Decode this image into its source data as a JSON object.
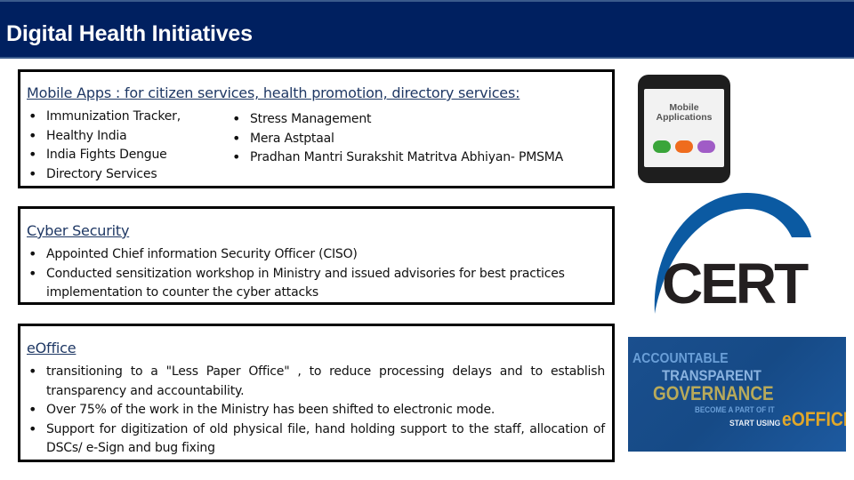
{
  "header": {
    "title": "Digital Health Initiatives"
  },
  "mobile_apps": {
    "heading": "Mobile Apps : for citizen services, health promotion, directory services:",
    "left_items": [
      "Immunization Tracker,",
      "Healthy India",
      "India Fights Dengue",
      "Directory Services"
    ],
    "right_items": [
      "Stress Management",
      "Mera Astptaal",
      "Pradhan Mantri  Surakshit  Matritva Abhiyan- PMSMA"
    ],
    "image_text": [
      "Mobile",
      "Applications"
    ],
    "app_colors": [
      "#3aa53a",
      "#ef6c1e",
      "#a05cc6"
    ]
  },
  "cyber_security": {
    "heading": "Cyber Security",
    "items": [
      "Appointed Chief information Security Officer (CISO)",
      "Conducted sensitization workshop in Ministry and issued advisories for best practices implementation to counter the cyber attacks"
    ],
    "logo_text": "CERT",
    "logo_arc_color": "#0b5aa2"
  },
  "eoffice": {
    "heading": "eOffice",
    "items": [
      "transitioning to a \"Less Paper Office\" , to reduce processing delays and  to establish transparency and accountability.",
      "Over 75% of the work in the Ministry has been shifted to electronic mode.",
      "Support for digitization of old physical file, hand holding support to the staff, allocation of DSCs/ e-Sign and bug fixing"
    ],
    "banner": {
      "line1": "ACCOUNTABLE",
      "line2": "TRANSPARENT",
      "line3": "GOVERNANCE",
      "line4": "BECOME A PART OF IT",
      "line5": "START USING",
      "line6": "eOFFICE"
    }
  }
}
